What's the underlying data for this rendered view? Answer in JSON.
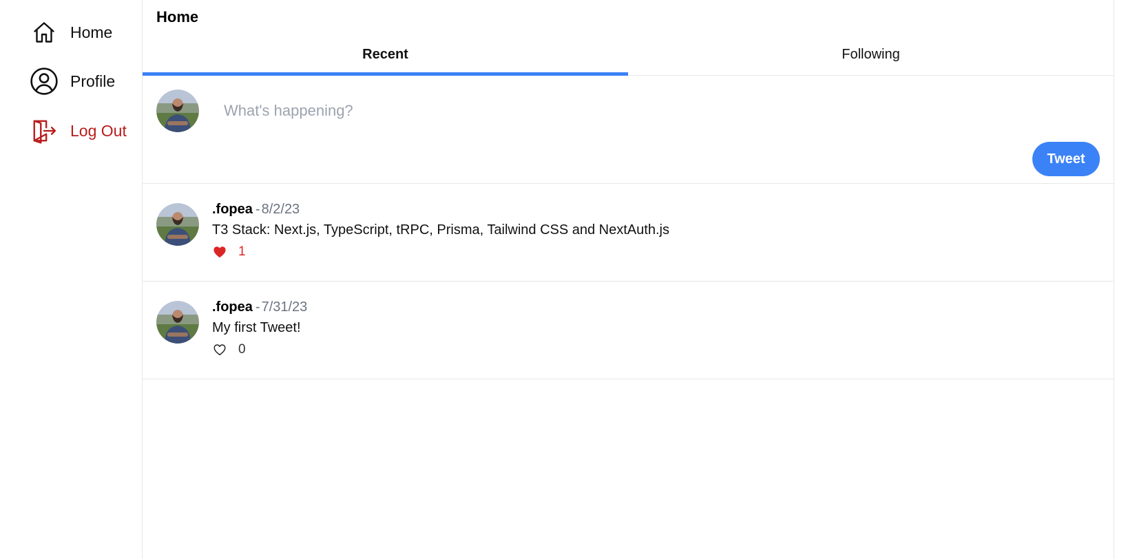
{
  "sidebar": {
    "items": [
      {
        "label": "Home",
        "icon": "home-icon"
      },
      {
        "label": "Profile",
        "icon": "user-circle-icon"
      },
      {
        "label": "Log Out",
        "icon": "logout-icon"
      }
    ]
  },
  "header": {
    "title": "Home"
  },
  "tabs": [
    {
      "label": "Recent",
      "active": true
    },
    {
      "label": "Following",
      "active": false
    }
  ],
  "compose": {
    "placeholder": "What's happening?",
    "button_label": "Tweet"
  },
  "tweets": [
    {
      "author": ".fopea",
      "separator": "-",
      "date": "8/2/23",
      "content": "T3 Stack: Next.js, TypeScript, tRPC, Prisma, Tailwind CSS and NextAuth.js",
      "likes": "1",
      "liked": true
    },
    {
      "author": ".fopea",
      "separator": "-",
      "date": "7/31/23",
      "content": "My first Tweet!",
      "likes": "0",
      "liked": false
    }
  ],
  "colors": {
    "accent": "#3b82f6",
    "danger": "#b91c1c",
    "like": "#dc2626",
    "muted": "#6b7280",
    "border": "#e5e7eb"
  }
}
